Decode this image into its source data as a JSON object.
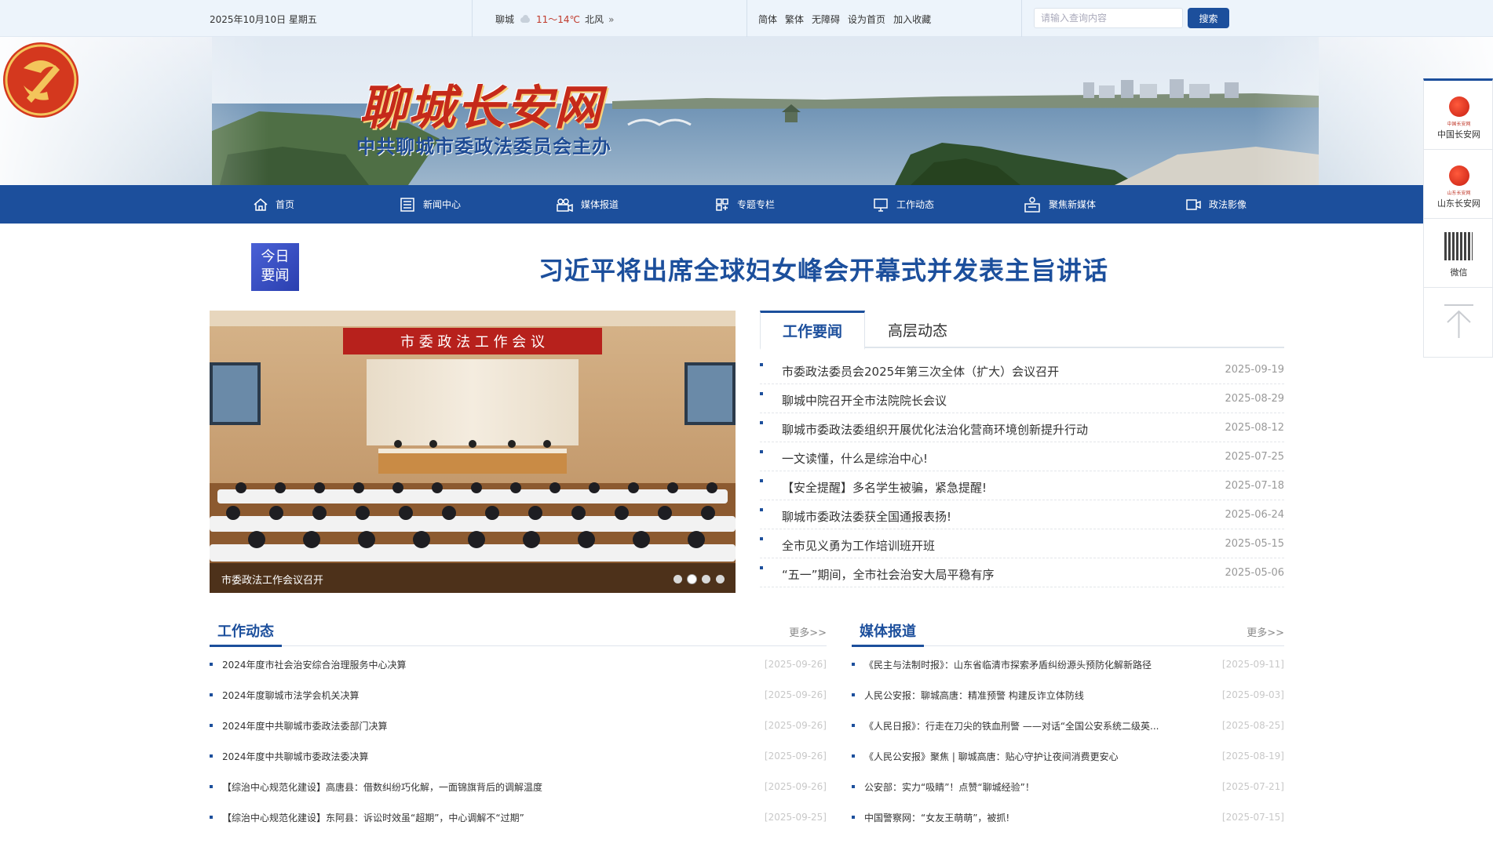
{
  "topbar": {
    "date": "2025年10月10日 星期五",
    "weather_city": "聊城",
    "weather_temp": "11～14℃",
    "weather_wind": "北风",
    "links": [
      "简体",
      "繁体",
      "无障碍",
      "设为首页",
      "加入收藏"
    ],
    "search_placeholder": "请输入查询内容",
    "search_button": "搜索"
  },
  "banner": {
    "title": "聊城长安网",
    "subtitle": "中共聊城市委政法委员会主办"
  },
  "nav": {
    "items": [
      {
        "label": "首页",
        "icon": "home-icon"
      },
      {
        "label": "新闻中心",
        "icon": "news-icon"
      },
      {
        "label": "媒体报道",
        "icon": "camera-icon"
      },
      {
        "label": "专题专栏",
        "icon": "grid-icon"
      },
      {
        "label": "工作动态",
        "icon": "monitor-icon"
      },
      {
        "label": "聚焦新媒体",
        "icon": "media-icon"
      },
      {
        "label": "政法影像",
        "icon": "video-icon"
      }
    ]
  },
  "float": {
    "items": [
      {
        "label": "中国长安网",
        "mini": "中国长安网"
      },
      {
        "label": "山东长安网",
        "mini": "山东长安网"
      },
      {
        "label": "微信"
      }
    ]
  },
  "headline": {
    "badge_line1": "今日",
    "badge_line2": "要闻",
    "text": "习近平将出席全球妇女峰会开幕式并发表主旨讲话"
  },
  "carousel": {
    "caption": "市委政法工作会议召开",
    "banner_text": "市 委 政 法 工 作 会 议",
    "dots": 4,
    "active_dot": 1
  },
  "news_tabs": {
    "tabs": [
      "工作要闻",
      "高层动态"
    ],
    "items": [
      {
        "title": "市委政法委员会2025年第三次全体（扩大）会议召开",
        "date": "2025-09-19"
      },
      {
        "title": "聊城中院召开全市法院院长会议",
        "date": "2025-08-29"
      },
      {
        "title": "聊城市委政法委组织开展优化法治化营商环境创新提升行动",
        "date": "2025-08-12"
      },
      {
        "title": "一文读懂，什么是综治中心!",
        "date": "2025-07-25"
      },
      {
        "title": "【安全提醒】多名学生被骗，紧急提醒!",
        "date": "2025-07-18"
      },
      {
        "title": "聊城市委政法委获全国通报表扬!",
        "date": "2025-06-24"
      },
      {
        "title": "全市见义勇为工作培训班开班",
        "date": "2025-05-15"
      },
      {
        "title": "“五一”期间，全市社会治安大局平稳有序",
        "date": "2025-05-06"
      }
    ]
  },
  "work": {
    "title": "工作动态",
    "more": "更多>>",
    "items": [
      {
        "title": "2024年度市社会治安综合治理服务中心决算",
        "date": "[2025-09-26]"
      },
      {
        "title": "2024年度聊城市法学会机关决算",
        "date": "[2025-09-26]"
      },
      {
        "title": "2024年度中共聊城市委政法委部门决算",
        "date": "[2025-09-26]"
      },
      {
        "title": "2024年度中共聊城市委政法委决算",
        "date": "[2025-09-26]"
      },
      {
        "title": "【综治中心规范化建设】高唐县：借数纠纷巧化解，一面锦旗背后的调解温度",
        "date": "[2025-09-26]"
      },
      {
        "title": "【综治中心规范化建设】东阿县：诉讼时效虽“超期”，中心调解不“过期”",
        "date": "[2025-09-25]"
      }
    ]
  },
  "media": {
    "title": "媒体报道",
    "more": "更多>>",
    "items": [
      {
        "title": "《民主与法制时报》：山东省临清市探索矛盾纠纷源头预防化解新路径",
        "date": "[2025-09-11]"
      },
      {
        "title": "人民公安报：聊城高唐：精准预警 构建反诈立体防线",
        "date": "[2025-09-03]"
      },
      {
        "title": "《人民日报》：行走在刀尖的铁血刑警 ——对话“全国公安系统二级英...",
        "date": "[2025-08-25]"
      },
      {
        "title": "《人民公安报》聚焦 | 聊城高唐：贴心守护让夜间消费更安心",
        "date": "[2025-08-19]"
      },
      {
        "title": "公安部：实力“吸睛”！点赞“聊城经验”！",
        "date": "[2025-07-21]"
      },
      {
        "title": "中国警察网：“女友王萌萌”，被抓!",
        "date": "[2025-07-15]"
      }
    ]
  },
  "colors": {
    "brand": "#1c4f9c",
    "topbar_bg": "#edf4fb",
    "title_red": "#c52a1a"
  }
}
